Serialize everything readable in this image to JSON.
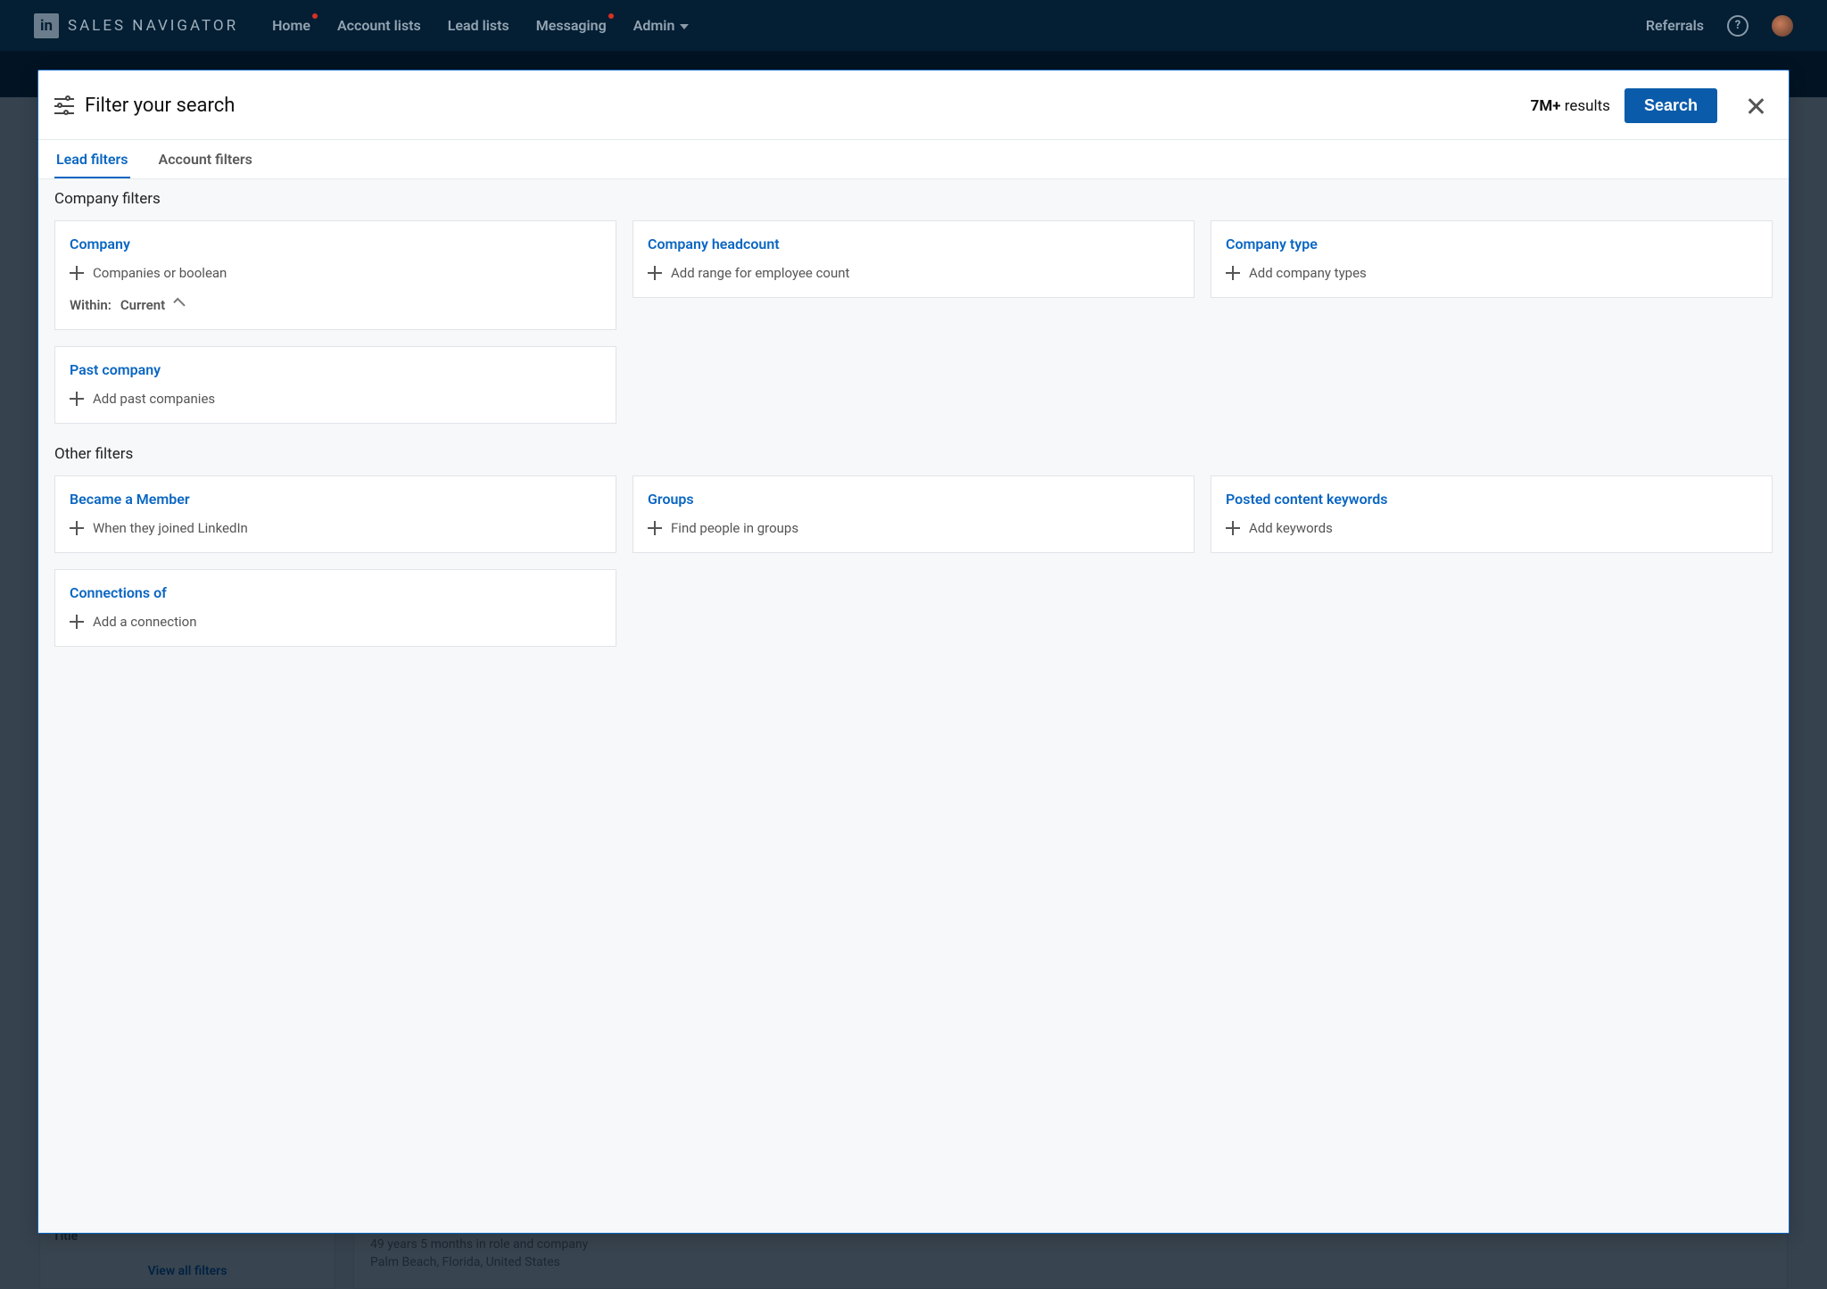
{
  "nav": {
    "brand": "SALES NAVIGATOR",
    "logo_mark": "in",
    "items": [
      "Home",
      "Account lists",
      "Lead lists",
      "Messaging",
      "Admin"
    ],
    "right": {
      "referrals": "Referrals"
    }
  },
  "modal": {
    "title": "Filter your search",
    "results_count": "7M+",
    "results_word": "results",
    "search_btn": "Search",
    "tabs": {
      "lead": "Lead filters",
      "account": "Account filters"
    },
    "sections": {
      "company": {
        "heading": "Company filters",
        "cards": {
          "company": {
            "title": "Company",
            "action": "Companies or boolean",
            "within_label": "Within:",
            "within_value": "Current"
          },
          "headcount": {
            "title": "Company headcount",
            "action": "Add range for employee count"
          },
          "type": {
            "title": "Company type",
            "action": "Add company types"
          },
          "past_company": {
            "title": "Past company",
            "action": "Add past companies"
          }
        }
      },
      "other": {
        "heading": "Other filters",
        "cards": {
          "member": {
            "title": "Became a Member",
            "action": "When they joined LinkedIn"
          },
          "groups": {
            "title": "Groups",
            "action": "Find people in groups"
          },
          "keywords": {
            "title": "Posted content keywords",
            "action": "Add keywords"
          },
          "conn_of": {
            "title": "Connections of",
            "action": "Add a connection"
          }
        }
      }
    }
  },
  "bg": {
    "left_title": "Title",
    "view_all": "View all filters",
    "tenure": "49 years 5 months in role and company",
    "location": "Palm Beach, Florida, United States"
  }
}
